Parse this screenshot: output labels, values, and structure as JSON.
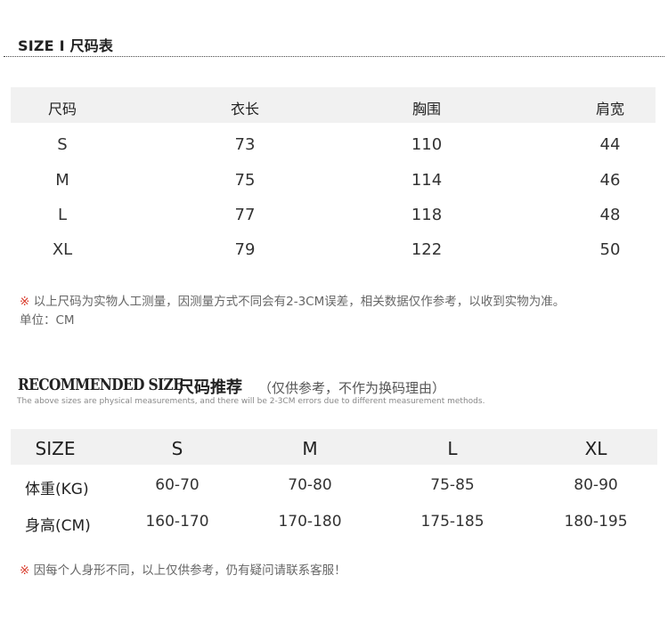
{
  "section1": {
    "title": "SIZE I 尺码表",
    "table": {
      "headers": [
        "尺码",
        "衣长",
        "胸围",
        "肩宽"
      ],
      "rows": [
        [
          "S",
          "73",
          "110",
          "44"
        ],
        [
          "M",
          "75",
          "114",
          "46"
        ],
        [
          "L",
          "77",
          "118",
          "48"
        ],
        [
          "XL",
          "79",
          "122",
          "50"
        ]
      ]
    },
    "note_mark": "※",
    "note": "以上尺码为实物人工测量，因测量方式不同会有2-3CM误差，相关数据仅作参考，以收到实物为准。",
    "unit": "单位：CM"
  },
  "section2": {
    "title_en": "RECOMMENDED SIZE",
    "title_cn": "尺码推荐",
    "subtitle": "（仅供参考，不作为换码理由）",
    "caption": "The above sizes are physical measurements, and there will be 2-3CM errors due to different measurement methods.",
    "table": {
      "headers": [
        "SIZE",
        "S",
        "M",
        "L",
        "XL"
      ],
      "rows": [
        {
          "label": "体重(KG)",
          "values": [
            "60-70",
            "70-80",
            "75-85",
            "80-90"
          ]
        },
        {
          "label": "身高(CM)",
          "values": [
            "160-170",
            "170-180",
            "175-185",
            "180-195"
          ]
        }
      ]
    },
    "note_mark": "※",
    "note": "因每个人身形不同，以上仅供参考，仍有疑问请联系客服！"
  }
}
